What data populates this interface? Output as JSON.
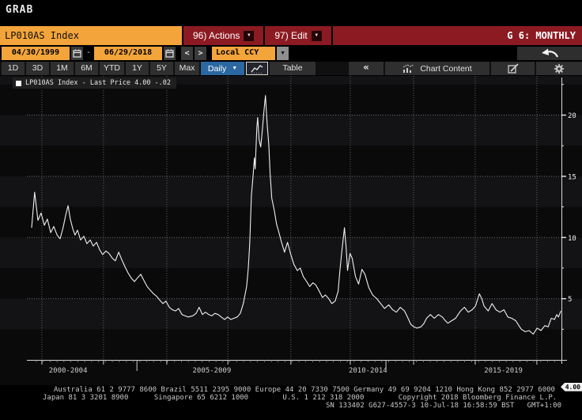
{
  "window": {
    "grab_label": "GRAB"
  },
  "security_bar": {
    "ticker": "LP010AS Index",
    "actions_label": "96) Actions",
    "edit_label": "97) Edit",
    "view_label": "G 6: MONTHLY"
  },
  "range_bar": {
    "start_date": "04/30/1999",
    "separator": "-",
    "end_date": "06/29/2018",
    "prev_label": "<",
    "next_label": ">",
    "currency": "Local CCY"
  },
  "period_bar": {
    "periods": [
      "1D",
      "3D",
      "1M",
      "6M",
      "YTD",
      "1Y",
      "5Y",
      "Max"
    ],
    "frequency": "Daily",
    "table_label": "Table",
    "collapse_label": "«",
    "chart_content_label": "Chart Content"
  },
  "legend": {
    "label": "LP010AS Index - Last Price",
    "last_price": "4.00",
    "change": "-.02"
  },
  "colors": {
    "amber": "#f3a43b",
    "banner_red": "#8c1a22",
    "frequency_blue": "#2b67a0",
    "series_line": "#f0f0f0",
    "badge_bg": "#f0f0f0",
    "stripe_dark": "#0a0a0b",
    "stripe_light": "#131316"
  },
  "chart_data": {
    "type": "line",
    "title": "LP010AS Index - Last Price",
    "series_name": "LP010AS Index",
    "last_price": 4.0,
    "change": -0.02,
    "xlim": [
      1999.33,
      2018.5
    ],
    "ylim": [
      0,
      23.2
    ],
    "yticks": [
      5,
      10,
      15,
      20
    ],
    "ytick_labels": [
      "5",
      "10",
      "15",
      "20"
    ],
    "y_minor_step": 2.5,
    "x_grid_years": [
      1999.7,
      2001.93,
      2004.22,
      2006.43,
      2008.71,
      2010.86,
      2013.15,
      2015.38,
      2017.61
    ],
    "x_boundary_ticks": [
      2003.14,
      2012.15
    ],
    "x_labels": [
      {
        "text": "2000-2004",
        "year": 2000.65
      },
      {
        "text": "2005-2009",
        "year": 2005.85
      },
      {
        "text": "2010-2014",
        "year": 2011.5
      },
      {
        "text": "2015-2019",
        "year": 2016.4
      }
    ],
    "points": [
      [
        1999.33,
        10.8
      ],
      [
        1999.44,
        13.7
      ],
      [
        1999.56,
        11.4
      ],
      [
        1999.67,
        12.0
      ],
      [
        1999.79,
        11.0
      ],
      [
        1999.9,
        11.5
      ],
      [
        2000.02,
        10.4
      ],
      [
        2000.13,
        10.9
      ],
      [
        2000.25,
        10.2
      ],
      [
        2000.36,
        9.9
      ],
      [
        2000.47,
        10.8
      ],
      [
        2000.56,
        11.8
      ],
      [
        2000.65,
        12.6
      ],
      [
        2000.73,
        11.5
      ],
      [
        2000.82,
        10.7
      ],
      [
        2000.9,
        10.2
      ],
      [
        2000.99,
        10.6
      ],
      [
        2001.1,
        9.8
      ],
      [
        2001.22,
        10.1
      ],
      [
        2001.33,
        9.5
      ],
      [
        2001.45,
        9.8
      ],
      [
        2001.56,
        9.3
      ],
      [
        2001.68,
        9.6
      ],
      [
        2001.79,
        9.0
      ],
      [
        2001.9,
        8.6
      ],
      [
        2002.02,
        8.9
      ],
      [
        2002.13,
        8.7
      ],
      [
        2002.25,
        8.3
      ],
      [
        2002.36,
        8.1
      ],
      [
        2002.48,
        8.8
      ],
      [
        2002.59,
        8.2
      ],
      [
        2002.71,
        7.6
      ],
      [
        2002.82,
        7.1
      ],
      [
        2002.93,
        6.7
      ],
      [
        2003.05,
        6.4
      ],
      [
        2003.16,
        6.7
      ],
      [
        2003.28,
        7.0
      ],
      [
        2003.39,
        6.5
      ],
      [
        2003.51,
        6.0
      ],
      [
        2003.62,
        5.7
      ],
      [
        2003.74,
        5.4
      ],
      [
        2003.85,
        5.2
      ],
      [
        2003.96,
        4.9
      ],
      [
        2004.08,
        4.6
      ],
      [
        2004.19,
        4.8
      ],
      [
        2004.31,
        4.3
      ],
      [
        2004.42,
        4.1
      ],
      [
        2004.54,
        4.0
      ],
      [
        2004.65,
        4.2
      ],
      [
        2004.77,
        3.7
      ],
      [
        2004.88,
        3.6
      ],
      [
        2004.99,
        3.5
      ],
      [
        2005.16,
        3.6
      ],
      [
        2005.28,
        3.8
      ],
      [
        2005.39,
        4.3
      ],
      [
        2005.51,
        3.7
      ],
      [
        2005.62,
        3.9
      ],
      [
        2005.74,
        3.7
      ],
      [
        2005.85,
        3.6
      ],
      [
        2005.96,
        3.8
      ],
      [
        2006.08,
        3.7
      ],
      [
        2006.19,
        3.5
      ],
      [
        2006.31,
        3.3
      ],
      [
        2006.42,
        3.5
      ],
      [
        2006.54,
        3.3
      ],
      [
        2006.65,
        3.4
      ],
      [
        2006.77,
        3.5
      ],
      [
        2006.88,
        3.8
      ],
      [
        2006.99,
        4.6
      ],
      [
        2007.11,
        6.0
      ],
      [
        2007.17,
        7.5
      ],
      [
        2007.22,
        9.5
      ],
      [
        2007.28,
        13.4
      ],
      [
        2007.34,
        15.0
      ],
      [
        2007.39,
        16.5
      ],
      [
        2007.42,
        15.6
      ],
      [
        2007.48,
        19.0
      ],
      [
        2007.51,
        19.8
      ],
      [
        2007.56,
        18.0
      ],
      [
        2007.62,
        17.4
      ],
      [
        2007.68,
        18.8
      ],
      [
        2007.73,
        20.2
      ],
      [
        2007.79,
        21.6
      ],
      [
        2007.85,
        19.3
      ],
      [
        2007.91,
        17.6
      ],
      [
        2007.96,
        15.2
      ],
      [
        2008.02,
        13.2
      ],
      [
        2008.11,
        12.2
      ],
      [
        2008.19,
        11.1
      ],
      [
        2008.28,
        10.4
      ],
      [
        2008.36,
        9.7
      ],
      [
        2008.48,
        8.8
      ],
      [
        2008.59,
        9.6
      ],
      [
        2008.71,
        8.6
      ],
      [
        2008.82,
        7.8
      ],
      [
        2008.94,
        7.3
      ],
      [
        2009.05,
        7.5
      ],
      [
        2009.16,
        6.8
      ],
      [
        2009.28,
        6.4
      ],
      [
        2009.39,
        6.0
      ],
      [
        2009.51,
        6.3
      ],
      [
        2009.62,
        6.1
      ],
      [
        2009.74,
        5.6
      ],
      [
        2009.85,
        5.1
      ],
      [
        2009.96,
        5.3
      ],
      [
        2010.08,
        5.0
      ],
      [
        2010.19,
        4.6
      ],
      [
        2010.31,
        4.8
      ],
      [
        2010.42,
        5.6
      ],
      [
        2010.48,
        7.2
      ],
      [
        2010.56,
        9.0
      ],
      [
        2010.65,
        10.8
      ],
      [
        2010.71,
        9.2
      ],
      [
        2010.76,
        7.3
      ],
      [
        2010.85,
        8.7
      ],
      [
        2010.93,
        8.3
      ],
      [
        2011.05,
        6.8
      ],
      [
        2011.16,
        6.2
      ],
      [
        2011.28,
        7.4
      ],
      [
        2011.39,
        7.0
      ],
      [
        2011.53,
        5.9
      ],
      [
        2011.67,
        5.3
      ],
      [
        2011.82,
        5.0
      ],
      [
        2011.96,
        4.6
      ],
      [
        2012.1,
        4.2
      ],
      [
        2012.25,
        4.5
      ],
      [
        2012.39,
        4.1
      ],
      [
        2012.53,
        3.9
      ],
      [
        2012.67,
        4.3
      ],
      [
        2012.82,
        4.0
      ],
      [
        2012.93,
        3.5
      ],
      [
        2013.05,
        2.9
      ],
      [
        2013.16,
        2.7
      ],
      [
        2013.27,
        2.6
      ],
      [
        2013.42,
        2.7
      ],
      [
        2013.53,
        3.0
      ],
      [
        2013.62,
        3.4
      ],
      [
        2013.76,
        3.7
      ],
      [
        2013.9,
        3.4
      ],
      [
        2014.05,
        3.7
      ],
      [
        2014.19,
        3.5
      ],
      [
        2014.3,
        3.2
      ],
      [
        2014.39,
        3.0
      ],
      [
        2014.53,
        3.2
      ],
      [
        2014.67,
        3.4
      ],
      [
        2014.85,
        4.0
      ],
      [
        2014.99,
        4.3
      ],
      [
        2015.13,
        3.9
      ],
      [
        2015.27,
        4.1
      ],
      [
        2015.39,
        4.4
      ],
      [
        2015.53,
        5.4
      ],
      [
        2015.62,
        5.0
      ],
      [
        2015.7,
        4.4
      ],
      [
        2015.85,
        4.0
      ],
      [
        2015.99,
        4.6
      ],
      [
        2016.13,
        4.1
      ],
      [
        2016.27,
        3.9
      ],
      [
        2016.42,
        4.1
      ],
      [
        2016.56,
        3.5
      ],
      [
        2016.7,
        3.4
      ],
      [
        2016.85,
        3.2
      ],
      [
        2016.96,
        2.8
      ],
      [
        2017.05,
        2.5
      ],
      [
        2017.19,
        2.3
      ],
      [
        2017.33,
        2.4
      ],
      [
        2017.48,
        2.1
      ],
      [
        2017.62,
        2.6
      ],
      [
        2017.76,
        2.4
      ],
      [
        2017.9,
        2.8
      ],
      [
        2018.02,
        2.7
      ],
      [
        2018.13,
        3.4
      ],
      [
        2018.25,
        3.3
      ],
      [
        2018.33,
        3.7
      ],
      [
        2018.39,
        3.5
      ],
      [
        2018.48,
        4.0
      ]
    ]
  },
  "footer": {
    "line1": "Australia 61 2 9777 8600 Brazil 5511 2395 9000 Europe 44 20 7330 7500 Germany 49 69 9204 1210 Hong Kong 852 2977 6000",
    "line2": "Japan 81 3 3201 8900      Singapore 65 6212 1000        U.S. 1 212 318 2000        Copyright 2018 Bloomberg Finance L.P.",
    "line3": "SN 133402 G627-4557-3 10-Jul-18 16:58:59 BST   GMT+1:00"
  }
}
